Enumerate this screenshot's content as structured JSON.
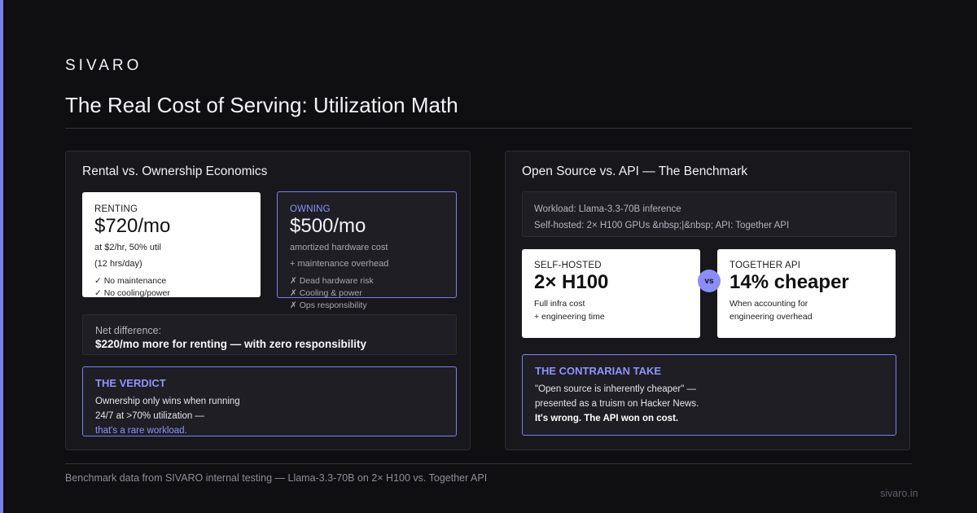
{
  "brand": "SIVARO",
  "title": "The Real Cost of Serving: Utilization Math",
  "left_panel": {
    "title": "Rental vs. Ownership Economics",
    "renting": {
      "label": "RENTING",
      "price": "$720/mo",
      "line1": "at $2/hr, 50% util",
      "line2": "(12 hrs/day)",
      "bullets": [
        "✓ No maintenance",
        "✓ No cooling/power"
      ]
    },
    "owning": {
      "label": "OWNING",
      "price": "$500/mo",
      "line1": "amortized hardware cost",
      "line2": "+ maintenance overhead",
      "bullets": [
        "✗ Dead hardware risk",
        "✗ Cooling & power",
        "✗ Ops responsibility"
      ]
    },
    "net": {
      "label": "Net difference:",
      "value": "$220/mo more for renting — with zero responsibility"
    },
    "verdict": {
      "heading": "THE VERDICT",
      "line1": "Ownership only wins when running",
      "line2": "24/7 at >70% utilization —",
      "highlight": "that's a rare workload."
    }
  },
  "right_panel": {
    "title": "Open Source vs. API — The Benchmark",
    "workload": {
      "line1": "Workload: Llama-3.3-70B inference",
      "line2": "Self-hosted: 2× H100 GPUs &nbsp;|&nbsp; API: Together API"
    },
    "self_hosted": {
      "label": "SELF-HOSTED",
      "value": "2× H100",
      "line1": "Full infra cost",
      "line2": "+ engineering time"
    },
    "vs_label": "vs",
    "together": {
      "label": "TOGETHER API",
      "value": "14% cheaper",
      "line1": "When accounting for",
      "line2": "engineering overhead"
    },
    "contrarian": {
      "heading": "THE CONTRARIAN TAKE",
      "line1": "\"Open source is inherently cheaper\" —",
      "line2": "presented as a truism on Hacker News.",
      "line3": "It's wrong. The API won on cost."
    }
  },
  "footer": "Benchmark data from SIVARO internal testing — Llama-3.3-70B on 2× H100 vs. Together API",
  "site": "sivaro.in",
  "colors": {
    "accent": "#7b7ff0",
    "background": "#0f0f12",
    "panel": "#18181c"
  }
}
